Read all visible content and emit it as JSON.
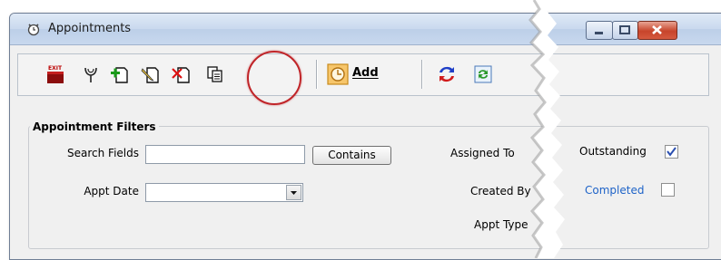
{
  "window": {
    "title": "Appointments"
  },
  "toolbar": {
    "exit_label": "EXIT",
    "add_label": "Add"
  },
  "filters": {
    "legend": "Appointment Filters",
    "search_fields_label": "Search Fields",
    "search_fields_value": "",
    "contains_button": "Contains",
    "appt_date_label": "Appt Date",
    "appt_date_value": "",
    "assigned_to_label": "Assigned To",
    "created_by_label": "Created By",
    "appt_type_label": "Appt Type",
    "outstanding_label": "Outstanding",
    "outstanding_checked": true,
    "completed_label": "Completed",
    "completed_checked": false
  },
  "colors": {
    "highlight_ring": "#c02428",
    "link": "#1e63c8",
    "titlebar": "#c9d9ee"
  }
}
